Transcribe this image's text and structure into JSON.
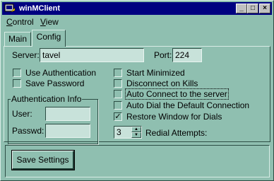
{
  "window": {
    "title": "winMClient",
    "icon": "app-icon"
  },
  "caption_buttons": {
    "minimize": "_",
    "maximize": "□",
    "close": "×"
  },
  "menu": [
    {
      "first": "C",
      "rest": "ontrol"
    },
    {
      "first": "V",
      "rest": "iew"
    }
  ],
  "tabs": {
    "main": "Main",
    "config": "Config"
  },
  "server": {
    "label": "Server:",
    "value": "tavel"
  },
  "port": {
    "label": "Port:",
    "value": "224"
  },
  "left_options": [
    {
      "label": "Use Authentication",
      "checked": false
    },
    {
      "label": "Save Password",
      "checked": false
    }
  ],
  "auth": {
    "title": "Authentication Info",
    "user_label": "User:",
    "user_value": "",
    "passwd_label": "Passwd:",
    "passwd_value": ""
  },
  "right_options": [
    {
      "label": "Start Minimized",
      "checked": false
    },
    {
      "label": "Disconnect on Kills",
      "checked": false
    },
    {
      "label": "Auto Connect to the server",
      "checked": false,
      "focused": true
    },
    {
      "label": "Auto Dial the Default Connection",
      "checked": false
    },
    {
      "label": "Restore Window for Dials",
      "checked": true
    }
  ],
  "redial": {
    "value": "3",
    "label": "Redial Attempts:"
  },
  "save_button": "Save Settings",
  "colors": {
    "face": "#8fbfb0",
    "titlebar": "#000080",
    "field": "#c8e2da"
  }
}
